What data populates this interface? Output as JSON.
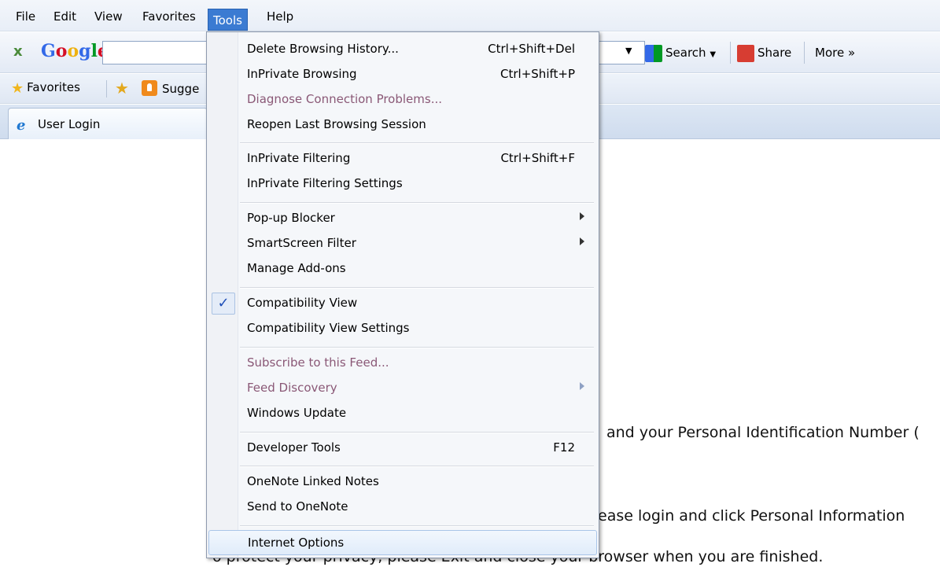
{
  "menubar": {
    "items": [
      "File",
      "Edit",
      "View",
      "Favorites",
      "Tools",
      "Help"
    ]
  },
  "google_toolbar": {
    "close": "x",
    "logo": "Google",
    "search_label": "Search",
    "share_label": "Share",
    "more_label": "More »"
  },
  "favorites_bar": {
    "favorites_label": "Favorites",
    "suggested_label": "Sugge"
  },
  "tab": {
    "title": "User Login"
  },
  "content": {
    "line1": "and your Personal Identification Number (",
    "line2": "ease login and click Personal Information",
    "line3": "o protect your privacy, please Exit and close your browser when you are finished."
  },
  "tools_menu": {
    "items": [
      {
        "label": "Delete Browsing History...",
        "shortcut": "Ctrl+Shift+Del"
      },
      {
        "label": "InPrivate Browsing",
        "shortcut": "Ctrl+Shift+P"
      },
      {
        "label": "Diagnose Connection Problems...",
        "shortcut": ""
      },
      {
        "label": "Reopen Last Browsing Session",
        "shortcut": ""
      },
      {
        "label": "InPrivate Filtering",
        "shortcut": "Ctrl+Shift+F"
      },
      {
        "label": "InPrivate Filtering Settings",
        "shortcut": ""
      },
      {
        "label": "Pop-up Blocker",
        "shortcut": ""
      },
      {
        "label": "SmartScreen Filter",
        "shortcut": ""
      },
      {
        "label": "Manage Add-ons",
        "shortcut": ""
      },
      {
        "label": "Compatibility View",
        "shortcut": "",
        "checked": true
      },
      {
        "label": "Compatibility View Settings",
        "shortcut": ""
      },
      {
        "label": "Subscribe to this Feed...",
        "shortcut": ""
      },
      {
        "label": "Feed Discovery",
        "shortcut": ""
      },
      {
        "label": "Windows Update",
        "shortcut": ""
      },
      {
        "label": "Developer Tools",
        "shortcut": "F12"
      },
      {
        "label": "OneNote Linked Notes",
        "shortcut": ""
      },
      {
        "label": "Send to OneNote",
        "shortcut": ""
      },
      {
        "label": "Internet Options",
        "shortcut": ""
      }
    ],
    "check_glyph": "✓"
  }
}
